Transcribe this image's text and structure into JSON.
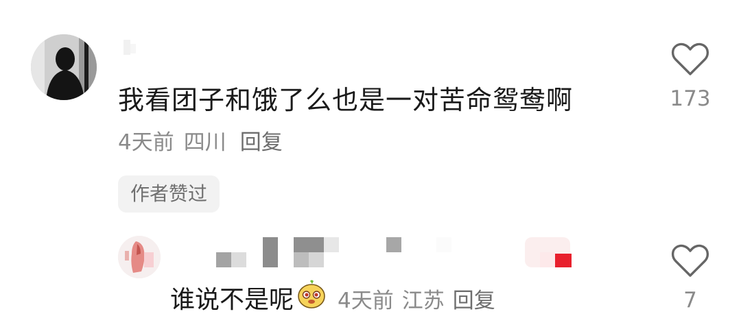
{
  "comment": {
    "text": "我看团子和饿了么也是一对苦命鸳鸯啊",
    "time": "4天前",
    "location": "四川",
    "reply_label": "回复",
    "author_badge": "作者赞过",
    "like_count": "173",
    "icons": {
      "like": "heart-outline-icon"
    }
  },
  "reply": {
    "text": "谁说不是呢",
    "sticker": "yellow-face-sticker",
    "time": "4天前",
    "location": "江苏",
    "reply_label": "回复",
    "like_count": "7",
    "icons": {
      "like": "heart-outline-icon"
    }
  },
  "colors": {
    "text_primary": "#1a1a1a",
    "text_secondary": "#8a8a8a",
    "badge_bg": "#f2f2f2",
    "heart_stroke": "#666666"
  }
}
